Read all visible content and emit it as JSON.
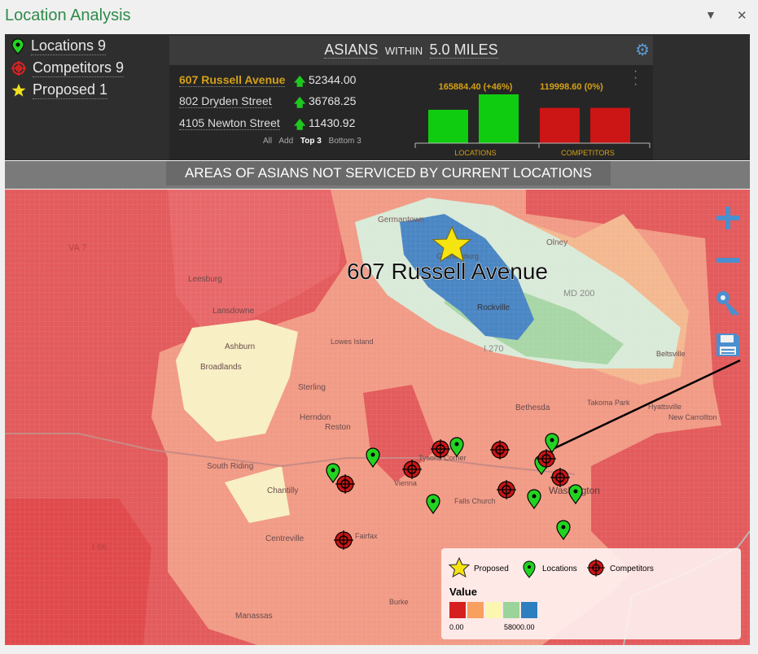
{
  "window": {
    "title": "Location Analysis",
    "menu_glyph": "▼",
    "close_glyph": "✕"
  },
  "legend_top": {
    "locations": "Locations 9",
    "competitors": "Competitors 9",
    "proposed": "Proposed 1"
  },
  "card": {
    "heading_main": "ASIANS",
    "heading_mid": "WITHIN",
    "heading_end": "5.0 MILES",
    "ranking": [
      {
        "name": "607 Russell Avenue",
        "value": "52344.00",
        "highlight": true
      },
      {
        "name": "802 Dryden Street",
        "value": "36768.25",
        "highlight": false
      },
      {
        "name": "4105 Newton Street",
        "value": "11430.92",
        "highlight": false
      }
    ],
    "filters": {
      "all": "All",
      "add": "Add",
      "top3": "Top 3",
      "bottom3": "Bottom 3"
    },
    "bar_chart": {
      "locations_label": "165884.40 (+46%)",
      "competitors_label": "119998.60 (0%)",
      "locations_axis": "LOCATIONS",
      "competitors_axis": "COMPETITORS"
    }
  },
  "chart_data": {
    "type": "bar",
    "groups": [
      "LOCATIONS",
      "COMPETITORS"
    ],
    "series": [
      {
        "values": [
          113540.4,
          119998.6
        ]
      },
      {
        "values": [
          165884.4,
          119998.6
        ]
      }
    ],
    "annotations": [
      "165884.40 (+46%)",
      "119998.60 (0%)"
    ],
    "colors": {
      "locations": "#10cc10",
      "competitors": "#cc1515"
    }
  },
  "banner": {
    "text": "AREAS OF ASIANS NOT SERVICED BY CURRENT LOCATIONS"
  },
  "map": {
    "proposed_label": "607 Russell Avenue",
    "place_labels": [
      "Germantown",
      "Gaithersburg",
      "Rockville",
      "Olney",
      "Leesburg",
      "Lansdowne",
      "Ashburn",
      "Broadlands",
      "Lowes Island",
      "Sterling",
      "Herndon",
      "Reston",
      "Bethesda",
      "Takoma Park",
      "Beltsville",
      "Hyattsville",
      "New Carrollton",
      "Tysons Corner",
      "Vienna",
      "Falls Church",
      "Washington",
      "South Riding",
      "Chantilly",
      "Centreville",
      "Fairfax",
      "Manassas",
      "Burke",
      "VA 7",
      "MD 200",
      "I 270",
      "I 66"
    ]
  },
  "map_legend": {
    "proposed": "Proposed",
    "locations": "Locations",
    "competitors": "Competitors",
    "value_title": "Value",
    "min": "0.00",
    "max": "58000.00",
    "ramp": [
      "#d62020",
      "#f7a060",
      "#fbf7b0",
      "#9bd49a",
      "#2d7fc0"
    ]
  },
  "colors": {
    "accent": "#2f8a4a",
    "highlight": "#d4a017",
    "up": "#1fc81f"
  }
}
